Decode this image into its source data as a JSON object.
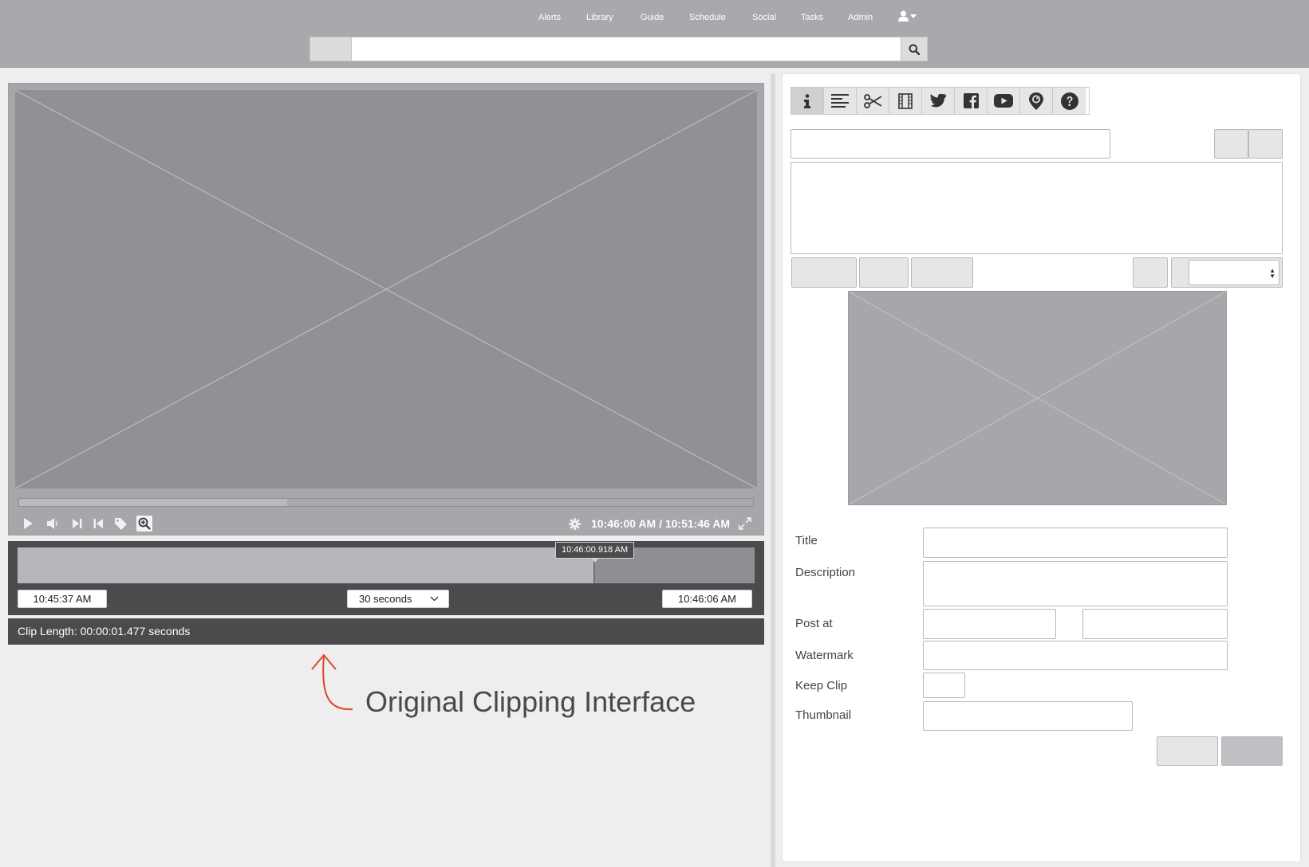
{
  "nav": {
    "items": [
      "Alerts",
      "Library",
      "Guide",
      "Schedule",
      "Social",
      "Tasks",
      "Admin"
    ],
    "user_icon": "user-icon",
    "caret_icon": "caret-down-icon"
  },
  "search": {
    "value": "",
    "placeholder": "",
    "button_icon": "search-icon"
  },
  "player": {
    "timecode": "10:46:00 AM / 10:51:46 AM",
    "buffered_fraction": 0.365,
    "controls": [
      "play-icon",
      "volume-icon",
      "skip-next-icon",
      "skip-previous-icon",
      "tag-icon",
      "zoom-in-icon",
      "settings-icon",
      "fullscreen-icon"
    ]
  },
  "clipper": {
    "marker_time": "10:46:00.918 AM",
    "selected_fraction": 0.782,
    "start_time": "10:45:37 AM",
    "duration": "30 seconds",
    "end_time": "10:46:06 AM",
    "clip_length": "Clip Length: 00:00:01.477 seconds"
  },
  "annotation": {
    "text": "Original Clipping Interface",
    "color": "#e0442b"
  },
  "panel": {
    "tabs": [
      "info-icon",
      "align-left-icon",
      "scissors-icon",
      "film-icon",
      "twitter-icon",
      "facebook-icon",
      "youtube-icon",
      "periscope-icon",
      "help-icon"
    ],
    "active_tab": 0,
    "form": {
      "title_label": "Title",
      "description_label": "Description",
      "post_at_label": "Post at",
      "watermark_label": "Watermark",
      "keep_clip_label": "Keep Clip",
      "thumbnail_label": "Thumbnail"
    }
  },
  "colors": {
    "header": "#a8a9ad",
    "clipper": "#4b4b4d",
    "accent_red": "#e0442b"
  }
}
